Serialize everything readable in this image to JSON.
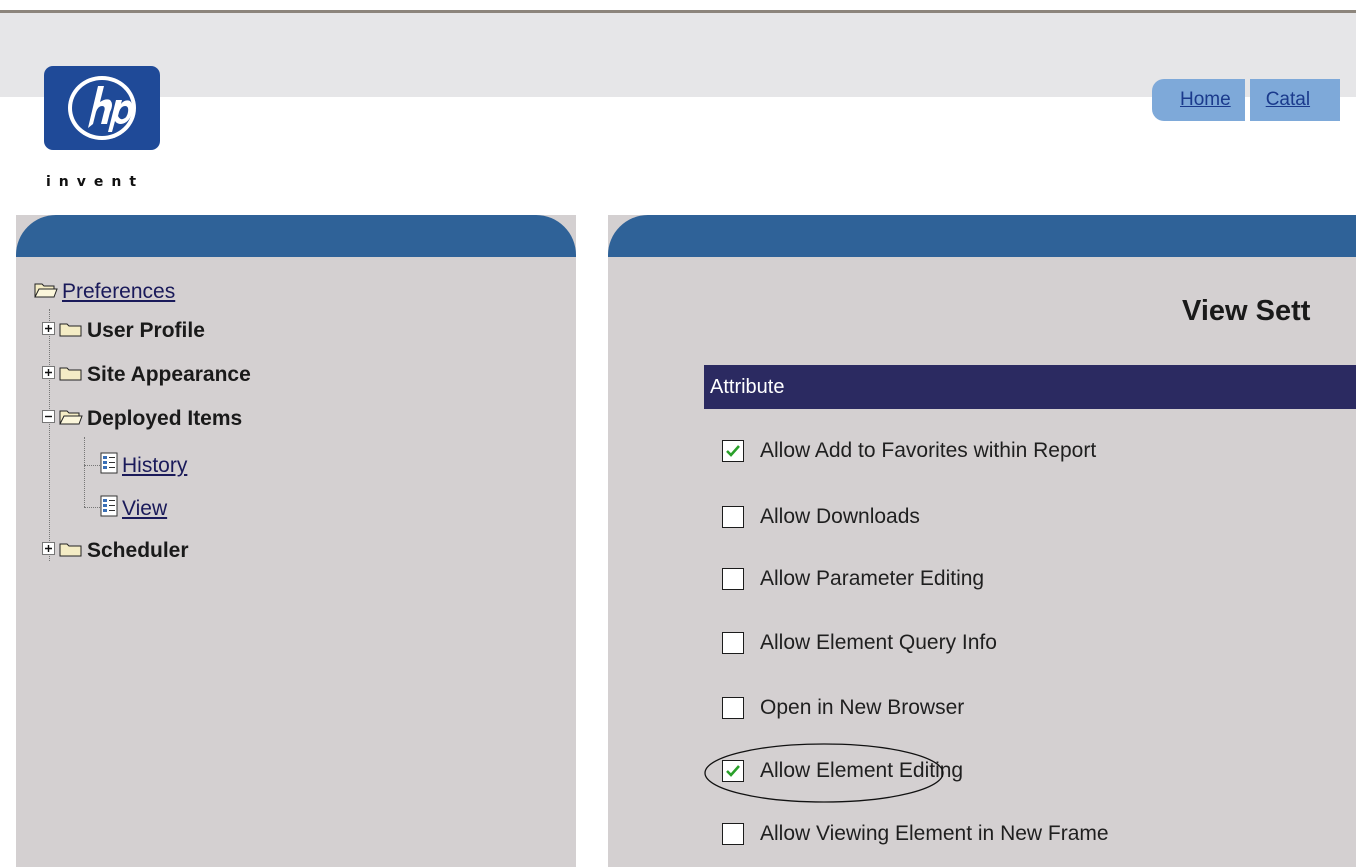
{
  "brand": {
    "logo_alt": "hp",
    "tagline": "invent"
  },
  "nav": {
    "tabs": [
      {
        "label": "Home"
      },
      {
        "label": "Catal"
      }
    ]
  },
  "sidebar": {
    "root": {
      "label": "Preferences",
      "icon": "open-folder-icon"
    },
    "items": [
      {
        "label": "User Profile",
        "expander": "+",
        "icon": "closed-folder-icon"
      },
      {
        "label": "Site Appearance",
        "expander": "+",
        "icon": "closed-folder-icon"
      },
      {
        "label": "Deployed Items",
        "expander": "-",
        "icon": "open-folder-icon",
        "children": [
          {
            "label": "History",
            "icon": "document-icon"
          },
          {
            "label": "View",
            "icon": "document-icon"
          }
        ]
      },
      {
        "label": "Scheduler",
        "expander": "+",
        "icon": "closed-folder-icon"
      }
    ]
  },
  "main": {
    "title": "View Sett",
    "table_header": "Attribute",
    "options": [
      {
        "label": "Allow Add to Favorites within Report",
        "checked": true
      },
      {
        "label": "Allow Downloads",
        "checked": false
      },
      {
        "label": "Allow Parameter Editing",
        "checked": false
      },
      {
        "label": "Allow Element Query Info",
        "checked": false
      },
      {
        "label": "Open in New Browser",
        "checked": false
      },
      {
        "label": "Allow Element Editing",
        "checked": true,
        "circled": true
      },
      {
        "label": "Allow Viewing Element in New Frame",
        "checked": false
      }
    ]
  },
  "colors": {
    "panel_header": "#2f6298",
    "attribute_header": "#2b2a61",
    "tab": "#7ea9d9",
    "check": "#2aa02a"
  }
}
